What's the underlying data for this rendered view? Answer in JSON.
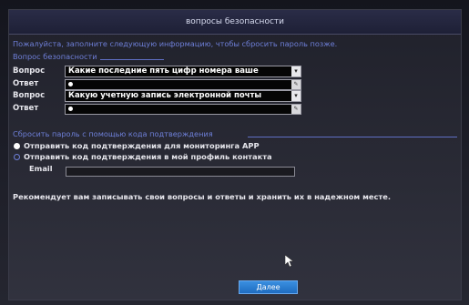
{
  "dialog": {
    "title": "вопросы безопасности",
    "intro": "Пожалуйста, заполните следующую информацию, чтобы сбросить пароль позже."
  },
  "security_section": {
    "label": "Вопрос безопасности",
    "rows": [
      {
        "kind": "question",
        "label": "Вопрос",
        "value": "Какие последние пять цифр номера ваше"
      },
      {
        "kind": "answer",
        "label": "Ответ",
        "value": ""
      },
      {
        "kind": "question",
        "label": "Вопрос",
        "value": "Какую учетную запись электронной почты"
      },
      {
        "kind": "answer",
        "label": "Ответ",
        "value": ""
      }
    ]
  },
  "reset_section": {
    "label": "Сбросить пароль с помощью кода подтверждения",
    "options": [
      {
        "label": "Отправить код подтверждения для мониторинга APP",
        "selected": true
      },
      {
        "label": "Отправить код подтверждения в мой профиль контакта",
        "selected": false
      }
    ],
    "email_label": "Email",
    "email_value": ""
  },
  "note": "Рекомендует вам записывать свои вопросы и ответы и хранить их в надежном месте.",
  "buttons": {
    "next_label": "Далее"
  },
  "icons": {
    "dropdown": "chevron-down-icon",
    "keyboard": "pencil-icon",
    "cursor": "mouse-pointer-icon"
  }
}
